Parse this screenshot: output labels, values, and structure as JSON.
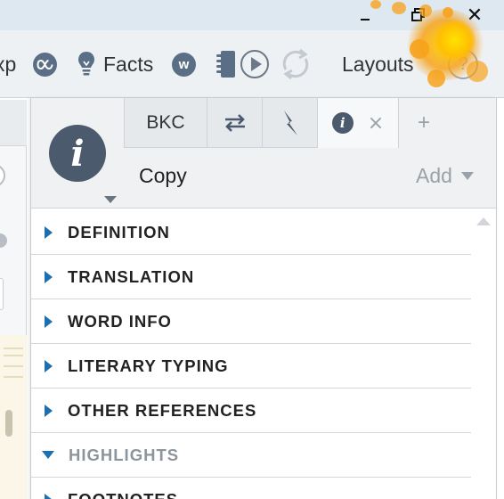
{
  "toolbar": {
    "exp_label": "xp",
    "atlas_icon": "atlas-icon",
    "facts_label": "Facts",
    "w_icon": "w",
    "layouts_label": "Layouts",
    "help_glyph": "?"
  },
  "panel": {
    "badge_glyph": "i",
    "tabs": [
      {
        "label": "BKC"
      },
      {
        "icon": "swap-arrows-icon",
        "glyph": "⇄"
      },
      {
        "icon": "lightning-icon",
        "glyph": "⚡"
      },
      {
        "icon": "info-icon",
        "glyph": "i",
        "close": "×"
      }
    ],
    "add_tab_glyph": "+",
    "copy_label": "Copy",
    "add_label": "Add"
  },
  "sections": [
    {
      "label": "DEFINITION",
      "expanded": false
    },
    {
      "label": "TRANSLATION",
      "expanded": false
    },
    {
      "label": "WORD INFO",
      "expanded": false
    },
    {
      "label": "LITERARY TYPING",
      "expanded": false
    },
    {
      "label": "OTHER REFERENCES",
      "expanded": false
    },
    {
      "label": "HIGHLIGHTS",
      "expanded": true
    },
    {
      "label": "FOOTNOTES",
      "expanded": false
    }
  ],
  "colors": {
    "accent_blue": "#1d6fb0",
    "badge_slate": "#4b5a6c",
    "splash_orange": "#f7a21b"
  }
}
